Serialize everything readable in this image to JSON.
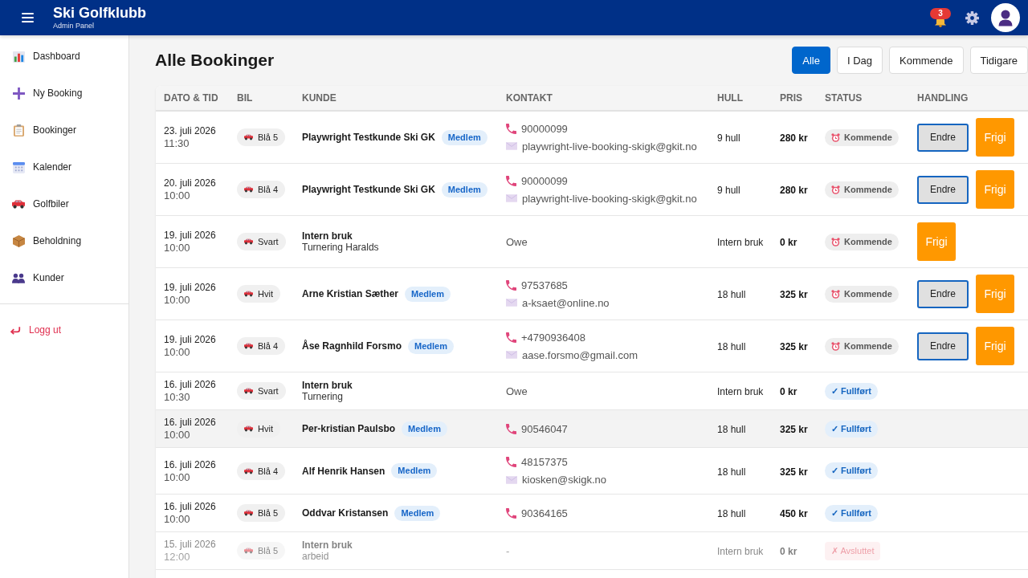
{
  "header": {
    "title": "Ski Golfklubb",
    "subtitle": "Admin Panel",
    "notification_count": "3"
  },
  "sidebar": {
    "items": [
      {
        "label": "Dashboard"
      },
      {
        "label": "Ny Booking"
      },
      {
        "label": "Bookinger"
      },
      {
        "label": "Kalender"
      },
      {
        "label": "Golfbiler"
      },
      {
        "label": "Beholdning"
      },
      {
        "label": "Kunder"
      }
    ],
    "logout": "Logg ut"
  },
  "page_title": "Alle Bookinger",
  "filters": [
    {
      "label": "Alle",
      "selected": true
    },
    {
      "label": "I Dag",
      "selected": false
    },
    {
      "label": "Kommende",
      "selected": false
    },
    {
      "label": "Tidigare",
      "selected": false
    }
  ],
  "table": {
    "columns": [
      "DATO & TID",
      "BIL",
      "KUNDE",
      "KONTAKT",
      "HULL",
      "PRIS",
      "STATUS",
      "HANDLING"
    ],
    "rows": [
      {
        "date": "23. juli 2026",
        "time": "11:30",
        "cart": "Blå 5",
        "customer": {
          "name": "Playwright Testkunde Ski GK",
          "badge": "Medlem"
        },
        "contact": {
          "phone": "90000099",
          "email": "playwright-live-booking-skigk@gkit.no"
        },
        "holes": "9 hull",
        "price": "280 kr",
        "status": {
          "kind": "upcoming",
          "label": "Kommende"
        },
        "actions": [
          {
            "kind": "edit",
            "label": "Endre"
          },
          {
            "kind": "release",
            "label": "Frigi"
          }
        ],
        "highlighted": false
      },
      {
        "date": "20. juli 2026",
        "time": "10:00",
        "cart": "Blå 4",
        "customer": {
          "name": "Playwright Testkunde Ski GK",
          "badge": "Medlem"
        },
        "contact": {
          "phone": "90000099",
          "email": "playwright-live-booking-skigk@gkit.no"
        },
        "holes": "9 hull",
        "price": "280 kr",
        "status": {
          "kind": "upcoming",
          "label": "Kommende"
        },
        "actions": [
          {
            "kind": "edit",
            "label": "Endre"
          },
          {
            "kind": "release",
            "label": "Frigi"
          }
        ],
        "highlighted": false
      },
      {
        "date": "19. juli 2026",
        "time": "10:00",
        "cart": "Svart",
        "customer": {
          "name": "Intern bruk",
          "note": "Turnering Haralds"
        },
        "contact": {
          "note": "Owe"
        },
        "holes": "Intern bruk",
        "price": "0 kr",
        "status": {
          "kind": "upcoming",
          "label": "Kommende"
        },
        "actions": [
          {
            "kind": "release",
            "label": "Frigi"
          }
        ],
        "highlighted": false
      },
      {
        "date": "19. juli 2026",
        "time": "10:00",
        "cart": "Hvit",
        "customer": {
          "name": "Arne Kristian Sæther",
          "badge": "Medlem"
        },
        "contact": {
          "phone": "97537685",
          "email": "a-ksaet@online.no"
        },
        "holes": "18 hull",
        "price": "325 kr",
        "status": {
          "kind": "upcoming",
          "label": "Kommende"
        },
        "actions": [
          {
            "kind": "edit",
            "label": "Endre"
          },
          {
            "kind": "release",
            "label": "Frigi"
          }
        ],
        "highlighted": false
      },
      {
        "date": "19. juli 2026",
        "time": "10:00",
        "cart": "Blå 4",
        "customer": {
          "name": "Åse Ragnhild Forsmo",
          "badge": "Medlem"
        },
        "contact": {
          "phone": "+4790936408",
          "email": "aase.forsmo@gmail.com"
        },
        "holes": "18 hull",
        "price": "325 kr",
        "status": {
          "kind": "upcoming",
          "label": "Kommende"
        },
        "actions": [
          {
            "kind": "edit",
            "label": "Endre"
          },
          {
            "kind": "release",
            "label": "Frigi"
          }
        ],
        "highlighted": false
      },
      {
        "date": "16. juli 2026",
        "time": "10:30",
        "cart": "Svart",
        "customer": {
          "name": "Intern bruk",
          "note": "Turnering"
        },
        "contact": {
          "note": "Owe"
        },
        "holes": "Intern bruk",
        "price": "0 kr",
        "status": {
          "kind": "completed",
          "label": "✓ Fullført"
        },
        "highlighted": false
      },
      {
        "date": "16. juli 2026",
        "time": "10:00",
        "cart": "Hvit",
        "customer": {
          "name": "Per-kristian Paulsbo",
          "badge": "Medlem"
        },
        "contact": {
          "phone": "90546047"
        },
        "holes": "18 hull",
        "price": "325 kr",
        "status": {
          "kind": "completed",
          "label": "✓ Fullført"
        },
        "highlighted": true
      },
      {
        "date": "16. juli 2026",
        "time": "10:00",
        "cart": "Blå 4",
        "customer": {
          "name": "Alf Henrik Hansen",
          "badge": "Medlem"
        },
        "contact": {
          "phone": "48157375",
          "email": "kiosken@skigk.no"
        },
        "holes": "18 hull",
        "price": "325 kr",
        "status": {
          "kind": "completed",
          "label": "✓ Fullført"
        },
        "highlighted": false
      },
      {
        "date": "16. juli 2026",
        "time": "10:00",
        "cart": "Blå 5",
        "customer": {
          "name": "Oddvar Kristansen",
          "badge": "Medlem"
        },
        "contact": {
          "phone": "90364165"
        },
        "holes": "18 hull",
        "price": "450 kr",
        "status": {
          "kind": "completed",
          "label": "✓ Fullført"
        },
        "highlighted": false
      },
      {
        "date": "15. juli 2026",
        "time": "12:00",
        "cart": "Blå 5",
        "customer": {
          "name": "Intern bruk",
          "note": "arbeid"
        },
        "contact": {
          "note": "-"
        },
        "holes": "Intern bruk",
        "price": "0 kr",
        "status": {
          "kind": "cancelled",
          "label": "✗ Avsluttet"
        },
        "highlighted": false
      }
    ]
  }
}
